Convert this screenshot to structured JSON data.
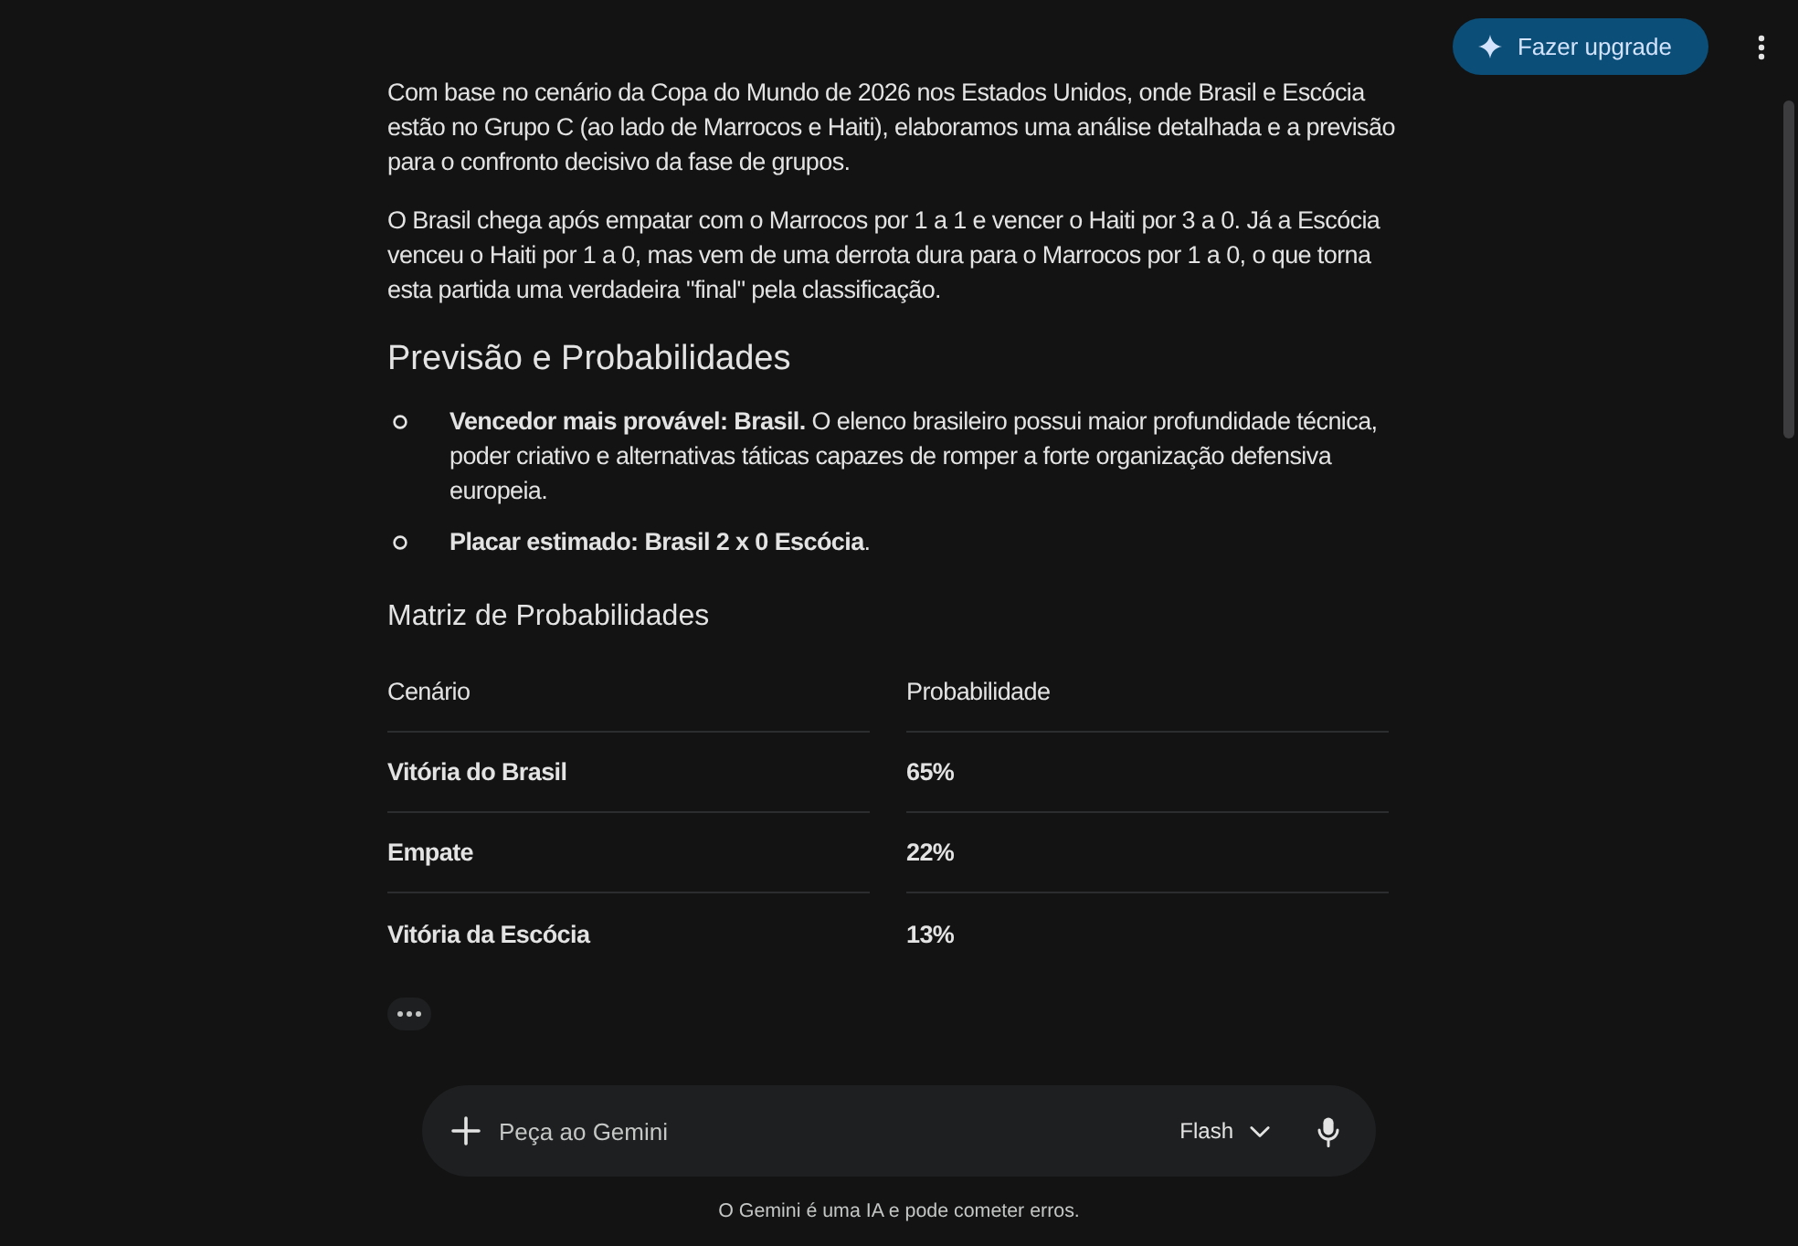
{
  "header": {
    "upgrade_button": "Fazer upgrade"
  },
  "response": {
    "paragraphs": [
      "Com base no cenário da Copa do Mundo de 2026 nos Estados Unidos, onde Brasil e Escócia estão no Grupo C (ao lado de Marrocos e Haiti), elaboramos uma análise detalhada e a previsão para o confronto decisivo da fase de grupos.",
      "O Brasil chega após empatar com o Marrocos por 1 a 1 e vencer o Haiti por 3 a 0. Já a Escócia venceu o Haiti por 1 a 0, mas vem de uma derrota dura para o Marrocos por 1 a 0, o que torna esta partida uma verdadeira \"final\" pela classificação."
    ],
    "heading": "Previsão e Probabilidades",
    "bullets": [
      "**Vencedor mais provável: Brasil.** O elenco brasileiro possui maior profundidade técnica, poder criativo e alternativas táticas capazes de romper a forte organização defensiva europeia.",
      "**Placar estimado: Brasil 2 x 0 Escócia**."
    ],
    "table_title": "Matriz de Probabilidades",
    "table": {
      "columns": [
        "Cenário",
        "Probabilidade"
      ],
      "rows": [
        [
          "Vitória do Brasil",
          "65%"
        ],
        [
          "Empate",
          "22%"
        ],
        [
          "Vitória da Escócia",
          "13%"
        ]
      ]
    }
  },
  "composer": {
    "placeholder": "Peça ao Gemini",
    "model": "Flash"
  },
  "disclaimer": "O Gemini é uma IA e pode cometer erros."
}
